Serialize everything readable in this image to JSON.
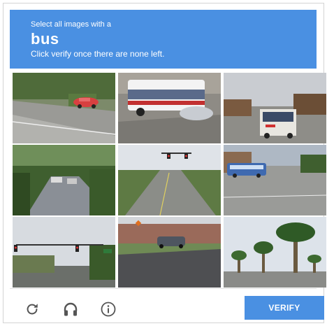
{
  "header": {
    "instruction": "Select all images with a",
    "target": "bus",
    "hint": "Click verify once there are none left."
  },
  "tiles": [
    {
      "name": "tile-1"
    },
    {
      "name": "tile-2"
    },
    {
      "name": "tile-3"
    },
    {
      "name": "tile-4"
    },
    {
      "name": "tile-5"
    },
    {
      "name": "tile-6"
    },
    {
      "name": "tile-7"
    },
    {
      "name": "tile-8"
    },
    {
      "name": "tile-9"
    }
  ],
  "footer": {
    "icons": [
      "reload-icon",
      "headphones-icon",
      "info-icon"
    ],
    "verify_label": "VERIFY"
  },
  "colors": {
    "accent": "#4a90e2",
    "icon": "#555555"
  }
}
